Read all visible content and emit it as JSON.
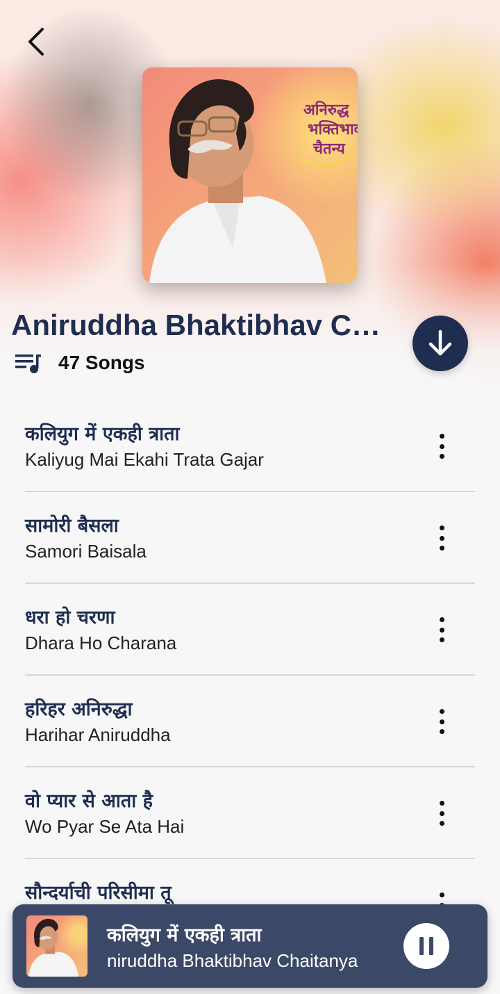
{
  "header": {
    "album_title": "Aniruddha Bhaktibhav Ch…",
    "song_count": "47 Songs",
    "cover_text": [
      "अनिरुद्ध",
      "भक्तिभाव",
      "चैतन्य"
    ]
  },
  "icons": {
    "back": "chevron-left-icon",
    "playlist": "queue-music-icon",
    "download": "arrow-down-icon",
    "more": "more-vertical-icon",
    "pause": "pause-icon"
  },
  "songs": [
    {
      "title": "कलियुग में एकही त्राता",
      "subtitle": "Kaliyug Mai Ekahi Trata Gajar"
    },
    {
      "title": "सामोरी बैसला",
      "subtitle": "Samori Baisala"
    },
    {
      "title": "धरा हो चरणा",
      "subtitle": "Dhara Ho Charana"
    },
    {
      "title": "हरिहर अनिरुद्धा",
      "subtitle": "Harihar Aniruddha"
    },
    {
      "title": "वो प्यार से आता है",
      "subtitle": "Wo Pyar Se Ata Hai"
    },
    {
      "title": "सौन्दर्याची परिसीमा तू",
      "subtitle": ""
    }
  ],
  "mini_player": {
    "title": "कलियुग में एकही त्राता",
    "subtitle": "niruddha Bhaktibhav Chaitanya"
  },
  "colors": {
    "accent": "#1f2d50",
    "mini_player_bg": "#3b4867",
    "divider": "#d6d7dd"
  }
}
